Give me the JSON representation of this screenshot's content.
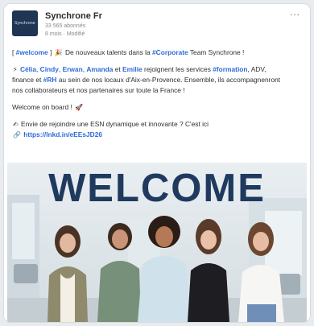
{
  "post": {
    "company_name": "Synchrone Fr",
    "followers": "33 565 abonnés",
    "time": "8 mois · Modifié",
    "logo_text": "Synchrone",
    "line1": {
      "pre": "[ ",
      "hashtag": "#welcome",
      "post": " ] ",
      "rest": " De nouveaux talents dans la ",
      "hashtag2": "#Corporate",
      "tail": " Team Synchrone !"
    },
    "line2": {
      "names": [
        "Célia",
        "Cindy",
        "Erwan",
        "Amanda"
      ],
      "and": " et ",
      "name5": "Emilie",
      "rest": " rejoignent les services ",
      "hashtag": "#formation",
      "tail": ", ADV,"
    },
    "line3": {
      "pre": "finance et ",
      "hashtag": "#RH",
      "tail": " au sein de nos locaux d'Aix-en-Provence. Ensemble, ils accompagnenront"
    },
    "line4": "nos collaborateurs et nos partenaires sur toute la France !",
    "line5": "Welcome on board ! ",
    "line6": " Envie de rejoindre une ESN dynamique et innovante ? C'est ici",
    "line7": "https://lnkd.in/eEEsJD26"
  },
  "image": {
    "headline": "WELCOME"
  },
  "icons": {
    "more": "more-options-icon",
    "sparkles": "sparkles-icon",
    "rocket": "rocket-icon",
    "writing": "writing-hand-icon",
    "link": "link-icon"
  },
  "colors": {
    "hashtag": "#2e6bd6",
    "headline": "#1f3a5e",
    "logo_bg": "#1f3553"
  }
}
